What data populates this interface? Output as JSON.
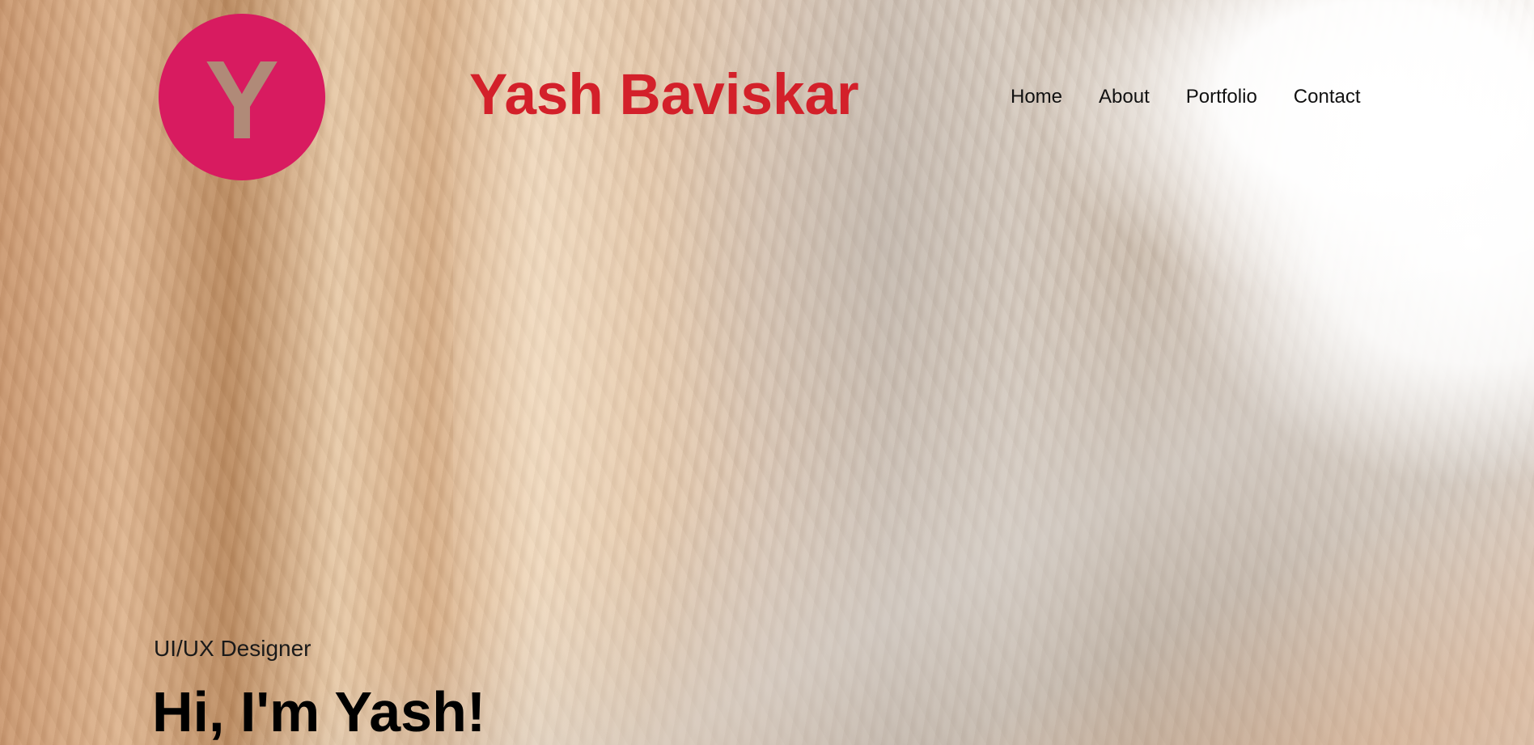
{
  "header": {
    "logo_letter": "Y",
    "site_title": "Yash Baviskar",
    "nav": [
      {
        "label": "Home"
      },
      {
        "label": "About"
      },
      {
        "label": "Portfolio"
      },
      {
        "label": "Contact"
      }
    ]
  },
  "hero": {
    "subtitle": "UI/UX Designer",
    "heading": "Hi, I'm Yash!"
  },
  "colors": {
    "logo_background": "#d81b60",
    "logo_letter": "#b08a78",
    "site_title": "#d3202a",
    "nav_text": "#111111",
    "heading_text": "#000000"
  },
  "icons": {
    "logo": "letter-y-monogram"
  }
}
